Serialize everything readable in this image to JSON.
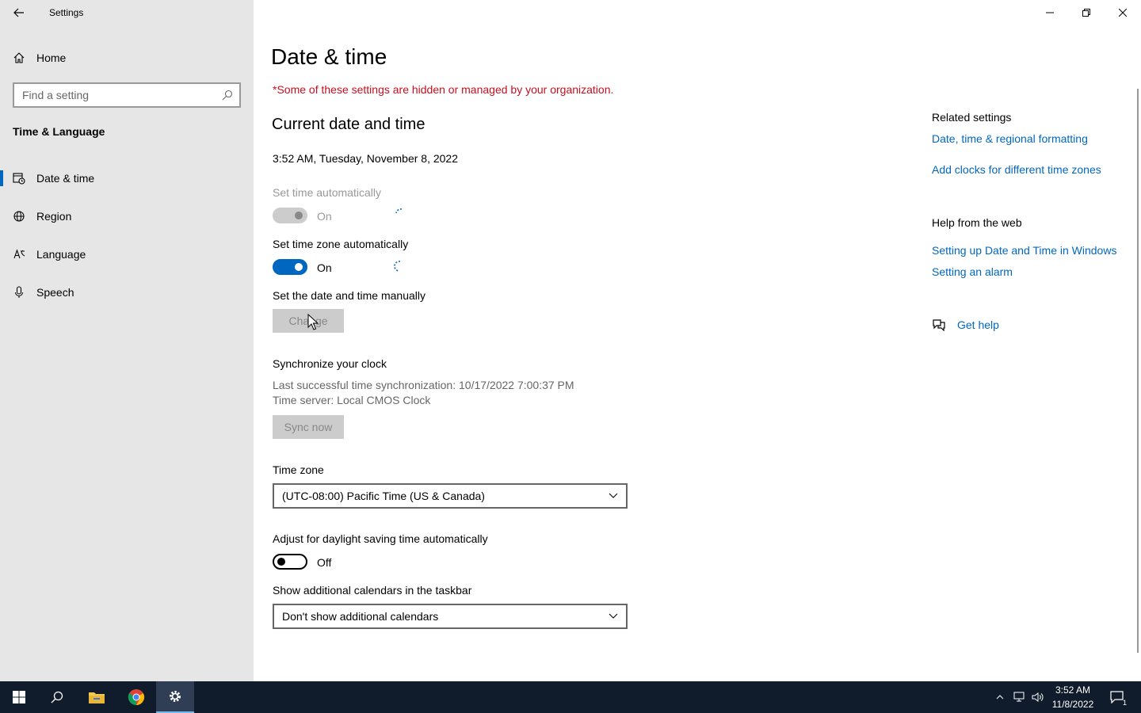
{
  "window": {
    "title": "Settings"
  },
  "sidebar": {
    "home_label": "Home",
    "search_placeholder": "Find a setting",
    "section_title": "Time & Language",
    "items": [
      {
        "label": "Date & time",
        "icon": "calendar-clock-icon"
      },
      {
        "label": "Region",
        "icon": "globe-icon"
      },
      {
        "label": "Language",
        "icon": "language-icon"
      },
      {
        "label": "Speech",
        "icon": "microphone-icon"
      }
    ]
  },
  "main": {
    "title": "Date & time",
    "warning": "*Some of these settings are hidden or managed by your organization.",
    "current_heading": "Current date and time",
    "current_value": "3:52 AM, Tuesday, November 8, 2022",
    "set_time_auto": {
      "label": "Set time automatically",
      "state": "On"
    },
    "set_tz_auto": {
      "label": "Set time zone automatically",
      "state": "On"
    },
    "manual": {
      "label": "Set the date and time manually",
      "button": "Change"
    },
    "sync": {
      "label": "Synchronize your clock",
      "last_sync": "Last successful time synchronization: 10/17/2022 7:00:37 PM",
      "server": "Time server: Local CMOS Clock",
      "button": "Sync now"
    },
    "timezone": {
      "label": "Time zone",
      "value": "(UTC-08:00) Pacific Time (US & Canada)"
    },
    "dst": {
      "label": "Adjust for daylight saving time automatically",
      "state": "Off"
    },
    "calendars": {
      "label": "Show additional calendars in the taskbar",
      "value": "Don't show additional calendars"
    }
  },
  "related": {
    "title": "Related settings",
    "links": [
      "Date, time & regional formatting",
      "Add clocks for different time zones"
    ],
    "help_title": "Help from the web",
    "help_links": [
      "Setting up Date and Time in Windows",
      "Setting an alarm"
    ],
    "get_help": "Get help"
  },
  "taskbar": {
    "time": "3:52 AM",
    "date": "11/8/2022",
    "notification_count": "1"
  },
  "colors": {
    "accent": "#0067c0",
    "warning": "#c50f1f",
    "taskbar": "#101c2c"
  }
}
